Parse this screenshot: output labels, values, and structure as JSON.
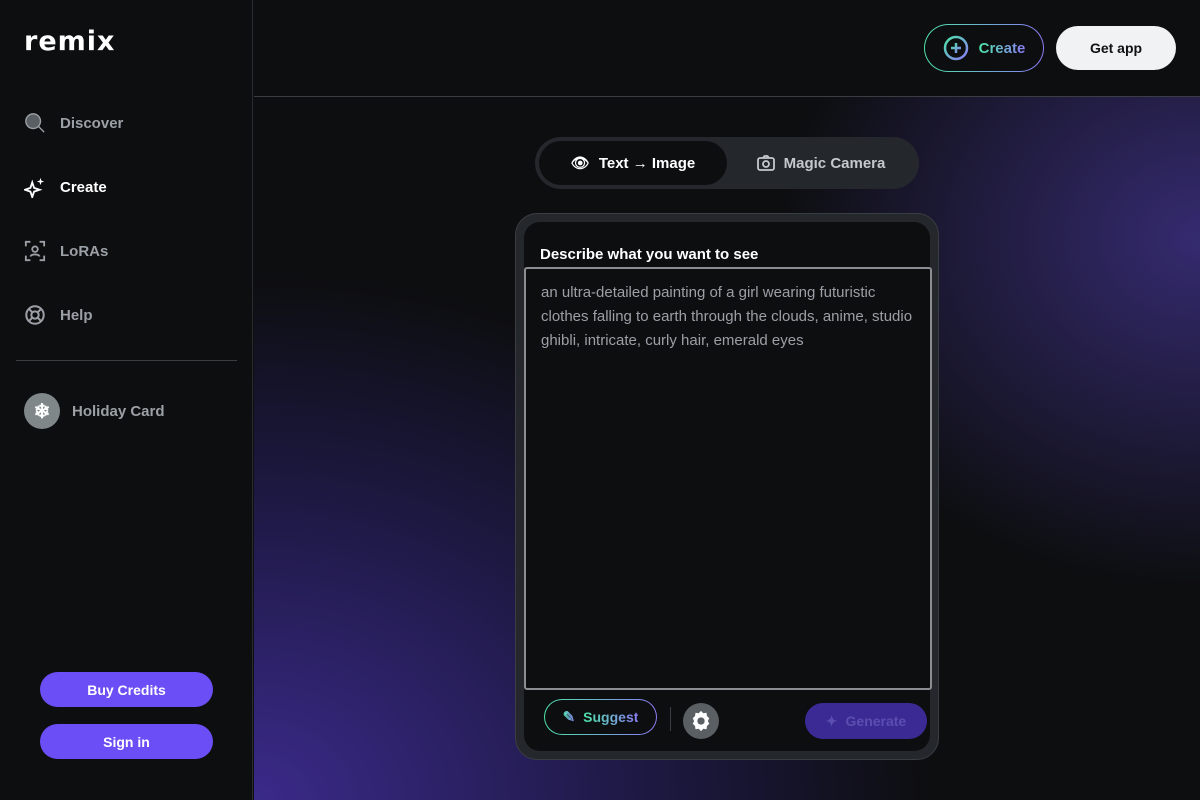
{
  "brand": "remix",
  "sidebar": {
    "items": [
      {
        "label": "Discover",
        "icon": "search-icon"
      },
      {
        "label": "Create",
        "icon": "sparkles-icon",
        "active": true
      },
      {
        "label": "LoRAs",
        "icon": "face-scan-icon"
      },
      {
        "label": "Help",
        "icon": "lifebuoy-icon"
      }
    ],
    "special": {
      "label": "Holiday Card",
      "icon": "snowflake-icon"
    },
    "buy_credits": "Buy Credits",
    "sign_in": "Sign in"
  },
  "header": {
    "create": "Create",
    "get_app": "Get app"
  },
  "tabs": [
    {
      "label": "Text → Image",
      "icon": "eye-icon",
      "active": true
    },
    {
      "label": "Magic Camera",
      "icon": "camera-icon"
    }
  ],
  "composer": {
    "label": "Describe what you want to see",
    "prompt": "an ultra-detailed painting of a girl wearing futuristic clothes falling to earth through the clouds, anime, studio ghibli, intricate, curly hair, emerald eyes",
    "suggest": "Suggest",
    "generate": "Generate"
  },
  "colors": {
    "accent": "#6b4ef6",
    "gradient_start": "#4ee4a8",
    "gradient_end": "#8b7cf6"
  }
}
